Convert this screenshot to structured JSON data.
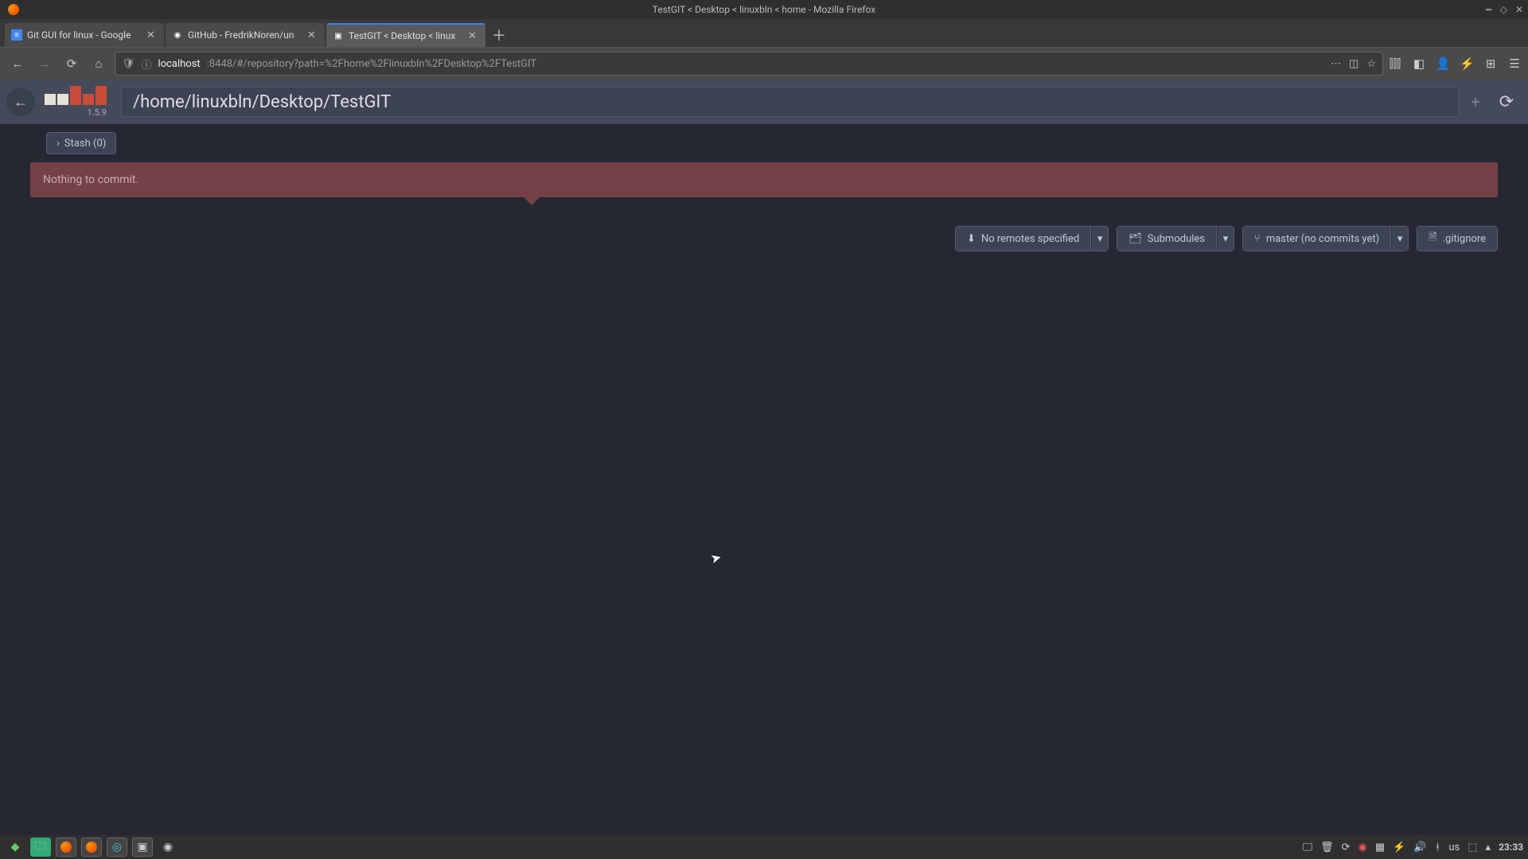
{
  "os": {
    "window_title": "TestGIT < Desktop < linuxbln < home - Mozilla Firefox"
  },
  "tabs": [
    {
      "label": "Git GUI for linux - Google"
    },
    {
      "label": "GitHub - FredrikNoren/un"
    },
    {
      "label": "TestGIT < Desktop < linux"
    }
  ],
  "url": {
    "host": "localhost",
    "rest": ":8448/#/repository?path=%2Fhome%2Flinuxbln%2FDesktop%2FTestGIT"
  },
  "ungit": {
    "version": "1.5.9",
    "path": "/home/linuxbln/Desktop/TestGIT",
    "stash_label": "Stash (0)",
    "commit_message": "Nothing to commit.",
    "buttons": {
      "remotes": "No remotes specified",
      "submodules": "Submodules",
      "branch": "master (no commits yet)",
      "gitignore": ".gitignore"
    }
  },
  "tray": {
    "kb": "us",
    "time": "23:33"
  }
}
